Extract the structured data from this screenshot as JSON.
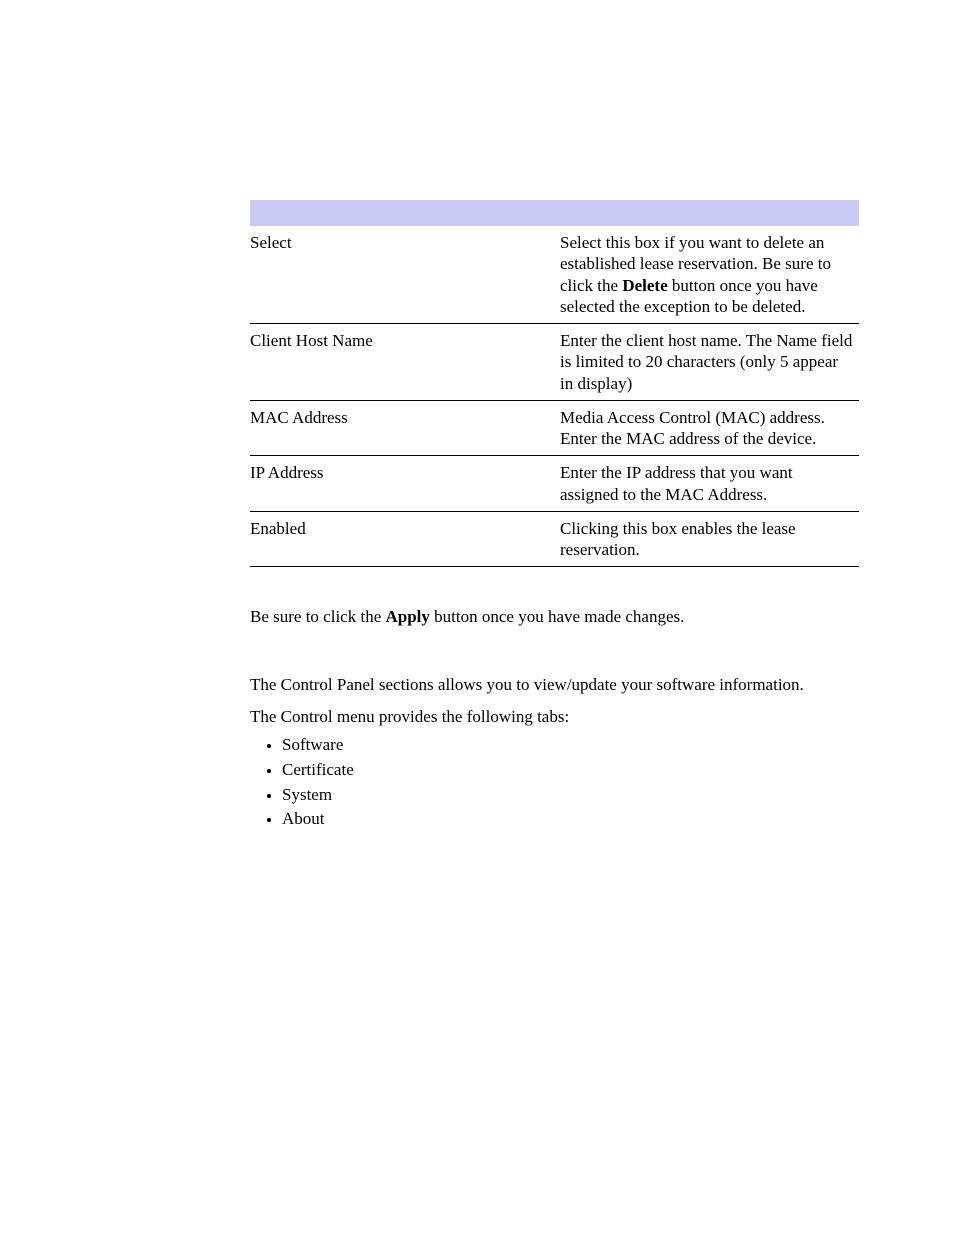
{
  "table": {
    "rows": [
      {
        "field": "Select",
        "desc_before": "Select this box if you want to delete an established lease reservation. Be sure to click the ",
        "desc_bold": "Delete",
        "desc_after": " button once you have selected the exception to be deleted."
      },
      {
        "field": "Client Host Name",
        "desc": "Enter the client host name. The Name field is limited to 20 characters (only 5 appear in display)"
      },
      {
        "field": "MAC Address",
        "desc": "Media Access Control (MAC) address. Enter the MAC address of the device."
      },
      {
        "field": "IP Address",
        "desc": "Enter the IP address that you want assigned to the MAC Address."
      },
      {
        "field": "Enabled",
        "desc": "Clicking this box enables the lease reservation."
      }
    ]
  },
  "note": {
    "before": "Be sure to click the ",
    "bold": "Apply",
    "after": " button once you have made changes."
  },
  "control": {
    "intro": "The Control Panel sections allows you to view/update your software information.",
    "lead": "The Control menu provides the following tabs:",
    "tabs": [
      "Software",
      "Certificate",
      "System",
      "About"
    ]
  }
}
